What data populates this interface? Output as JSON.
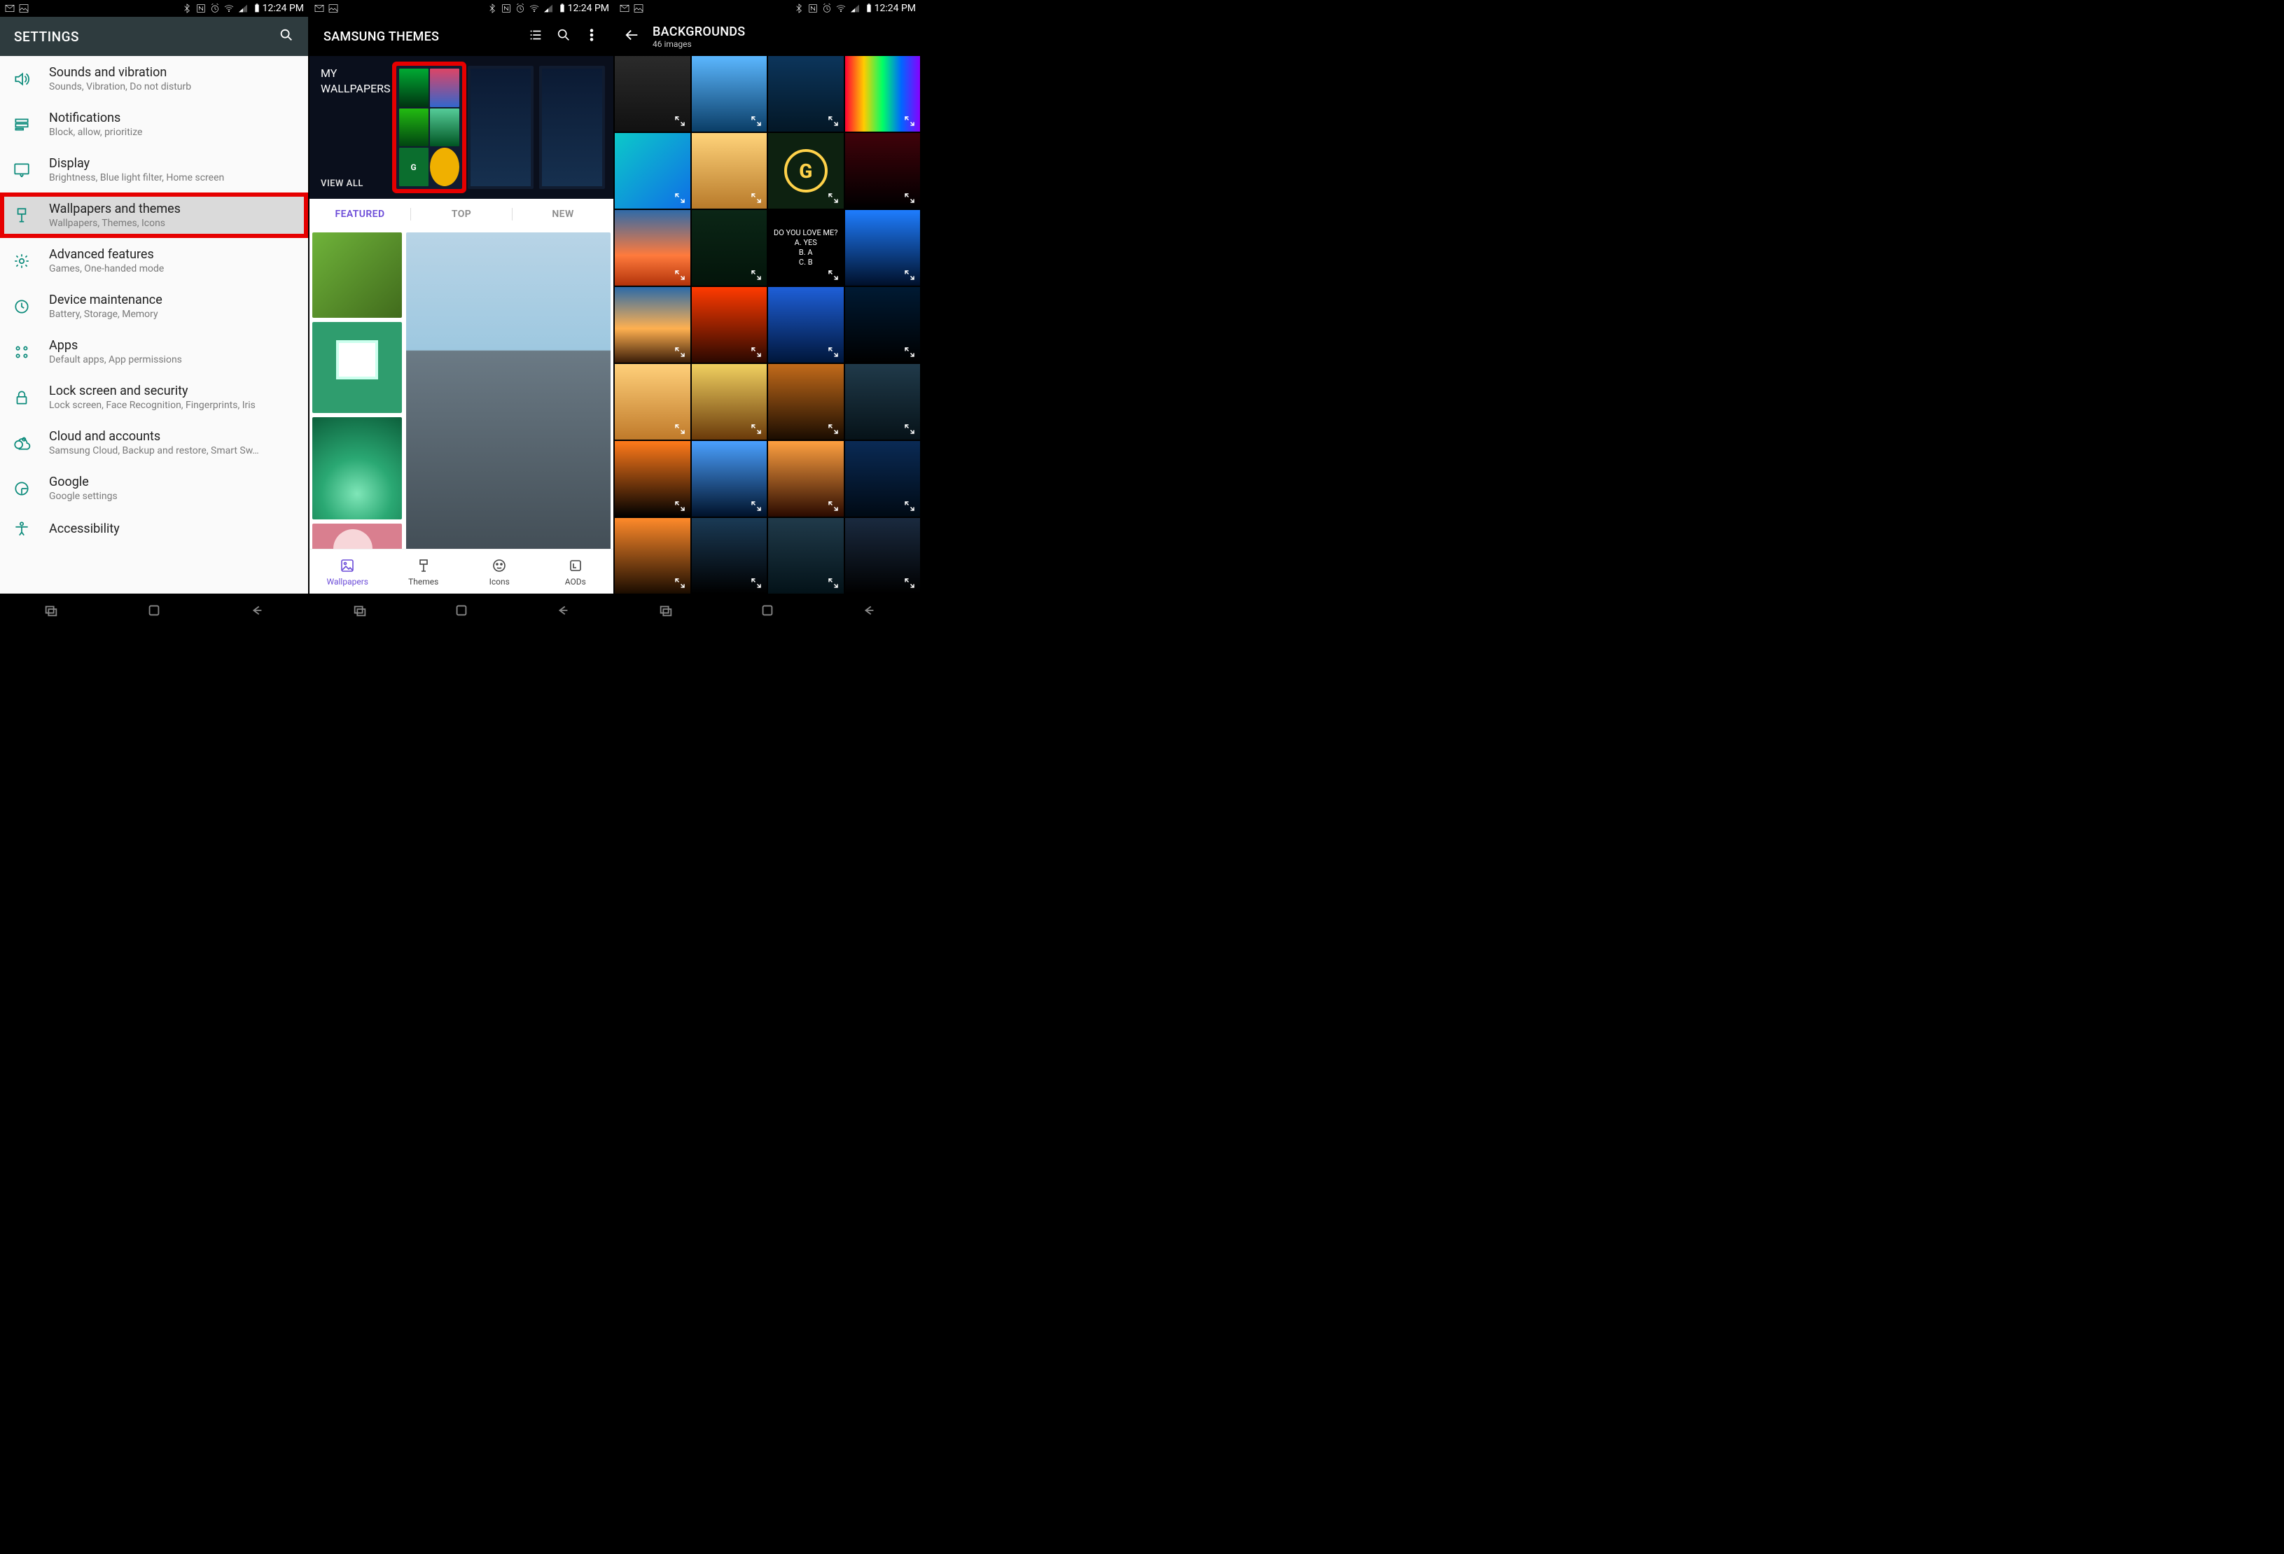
{
  "status": {
    "time": "12:24 PM"
  },
  "settings": {
    "title": "SETTINGS",
    "rows": [
      {
        "id": "sounds",
        "title": "Sounds and vibration",
        "sub": "Sounds, Vibration, Do not disturb"
      },
      {
        "id": "notifications",
        "title": "Notifications",
        "sub": "Block, allow, prioritize"
      },
      {
        "id": "display",
        "title": "Display",
        "sub": "Brightness, Blue light filter, Home screen"
      },
      {
        "id": "wallpapers-themes",
        "title": "Wallpapers and themes",
        "sub": "Wallpapers, Themes, Icons",
        "selected": true
      },
      {
        "id": "advanced",
        "title": "Advanced features",
        "sub": "Games, One-handed mode"
      },
      {
        "id": "device-maint",
        "title": "Device maintenance",
        "sub": "Battery, Storage, Memory"
      },
      {
        "id": "apps",
        "title": "Apps",
        "sub": "Default apps, App permissions"
      },
      {
        "id": "lockscreen",
        "title": "Lock screen and security",
        "sub": "Lock screen, Face Recognition, Fingerprints, Iris"
      },
      {
        "id": "cloud",
        "title": "Cloud and accounts",
        "sub": "Samsung Cloud, Backup and restore, Smart Sw…"
      },
      {
        "id": "google",
        "title": "Google",
        "sub": "Google settings"
      },
      {
        "id": "accessibility",
        "title": "Accessibility",
        "sub": ""
      }
    ]
  },
  "themes": {
    "title": "SAMSUNG THEMES",
    "hero_title_1": "MY",
    "hero_title_2": "WALLPAPERS",
    "viewall": "VIEW ALL",
    "tabs": [
      "FEATURED",
      "TOP",
      "NEW"
    ],
    "active_tab": 0,
    "bottom_tabs": [
      "Wallpapers",
      "Themes",
      "Icons",
      "AODs"
    ],
    "active_bottom": 0
  },
  "backgrounds": {
    "title": "BACKGROUNDS",
    "subtitle": "46 images",
    "text_tile": {
      "l1": "DO YOU LOVE ME?",
      "l2": "A. YES",
      "l3": "B. A",
      "l4": "C. B"
    }
  }
}
